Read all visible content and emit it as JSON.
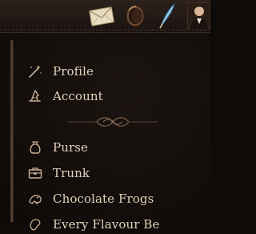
{
  "top_icons": [
    {
      "name": "envelope-icon"
    },
    {
      "name": "ring-icon"
    },
    {
      "name": "quill-icon"
    },
    {
      "name": "avatar"
    }
  ],
  "menu": {
    "profile": {
      "label": "Profile",
      "icon": "wand-icon"
    },
    "account": {
      "label": "Account",
      "icon": "hat-icon"
    },
    "purse": {
      "label": "Purse",
      "icon": "pouch-icon"
    },
    "trunk": {
      "label": "Trunk",
      "icon": "trunk-icon"
    },
    "chocolate_frogs": {
      "label": "Chocolate Frogs",
      "icon": "frog-icon"
    },
    "partial_item": {
      "label": "Every Flavour Be",
      "icon": "bean-icon"
    }
  },
  "colors": {
    "text": "#e3d2bd",
    "icon": "#c9b096",
    "accent": "#6a513f"
  }
}
